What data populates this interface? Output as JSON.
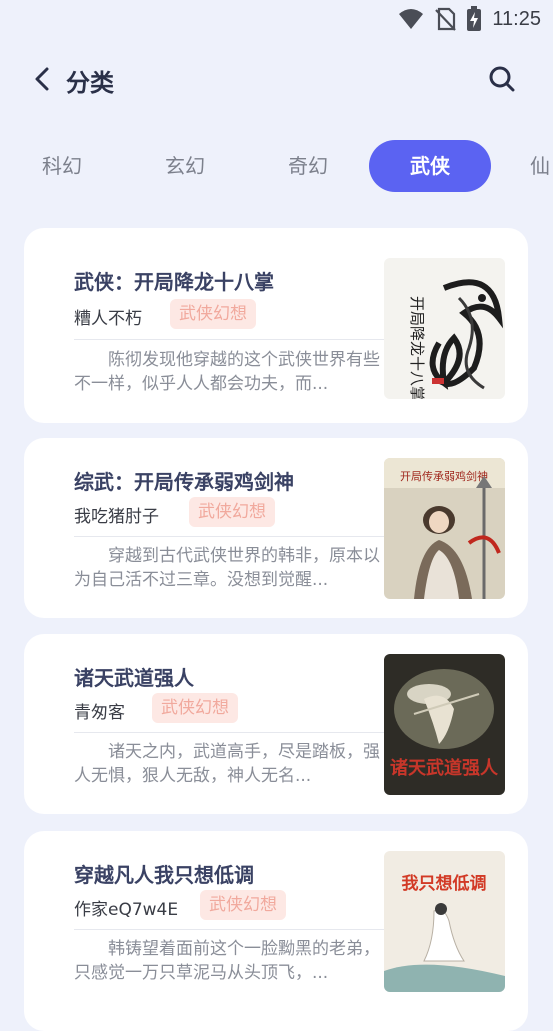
{
  "status_bar": {
    "time": "11:25",
    "icons": [
      "wifi-icon",
      "no-sim-icon",
      "battery-charging-icon"
    ]
  },
  "header": {
    "title": "分类",
    "back_icon": "chevron-left-icon",
    "search_icon": "search-icon"
  },
  "tabs": [
    {
      "label": "科幻",
      "active": false
    },
    {
      "label": "玄幻",
      "active": false
    },
    {
      "label": "奇幻",
      "active": false
    },
    {
      "label": "武侠",
      "active": true
    },
    {
      "label": "仙",
      "active": false
    }
  ],
  "colors": {
    "accent": "#5b63f2",
    "tag_bg": "#fde8e4",
    "tag_text": "#f1a99d",
    "page_bg": "#eef1fb"
  },
  "books": [
    {
      "title": "武侠：开局降龙十八掌",
      "author": "糟人不朽",
      "tag": "武侠幻想",
      "desc": "陈彻发现他穿越的这个武侠世界有些不一样，似乎人人都会功夫，而...",
      "cover_text": "开局降龙十八掌"
    },
    {
      "title": "综武：开局传承弱鸡剑神",
      "author": "我吃猪肘子",
      "tag": "武侠幻想",
      "desc": "穿越到古代武侠世界的韩非，原本以为自己活不过三章。没想到觉醒...",
      "cover_text": "开局传承弱鸡剑神"
    },
    {
      "title": "诸天武道强人",
      "author": "青匆客",
      "tag": "武侠幻想",
      "desc": "诸天之内，武道高手，尽是踏板，强人无惧，狠人无敌，神人无名...",
      "cover_text": "诸天武道强人"
    },
    {
      "title": "穿越凡人我只想低调",
      "author": "作家eQ7w4E",
      "tag": "武侠幻想",
      "desc": "韩铸望着面前这个一脸黝黑的老弟，只感觉一万只草泥马从头顶飞，...",
      "cover_text": "我只想低调"
    }
  ]
}
